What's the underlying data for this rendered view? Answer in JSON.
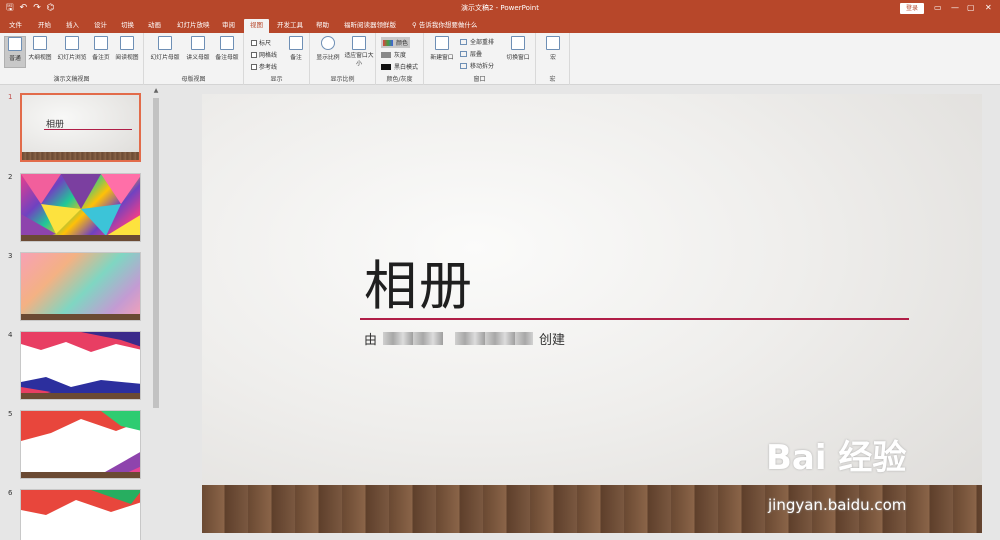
{
  "titlebar": {
    "qat": [
      "save-icon",
      "undo-icon",
      "redo-icon",
      "present-icon"
    ],
    "title": "演示文稿2 - PowerPoint",
    "login": "登录",
    "controls": [
      "▭",
      "—",
      "▢",
      "✕"
    ]
  },
  "tabs": [
    "文件",
    "开始",
    "插入",
    "设计",
    "切换",
    "动画",
    "幻灯片放映",
    "审阅",
    "视图",
    "开发工具",
    "帮助",
    "福昕阅读器领鲜版"
  ],
  "active_tab": "视图",
  "tell_me": "告诉我你想要做什么",
  "ribbon": {
    "presentation_views": {
      "label": "演示文稿视图",
      "buttons": [
        "普通",
        "大纲视图",
        "幻灯片浏览",
        "备注页",
        "阅读视图"
      ]
    },
    "master_views": {
      "label": "母版视图",
      "buttons": [
        "幻灯片母版",
        "讲义母版",
        "备注母版"
      ]
    },
    "show": {
      "label": "显示",
      "checks": [
        "标尺",
        "网格线",
        "参考线"
      ],
      "notes": "备注"
    },
    "zoom": {
      "label": "显示比例",
      "buttons": [
        "显示比例",
        "适应窗口大小"
      ]
    },
    "color": {
      "label": "颜色/灰度",
      "items": [
        "颜色",
        "灰度",
        "黑白模式"
      ]
    },
    "window": {
      "label": "窗口",
      "new_window": "新建窗口",
      "items": [
        "全部重排",
        "层叠",
        "移动拆分"
      ],
      "switch": "切换窗口"
    },
    "macros": {
      "label": "宏",
      "button": "宏"
    }
  },
  "thumbnails": [
    {
      "num": "1",
      "title": "相册"
    },
    {
      "num": "2"
    },
    {
      "num": "3"
    },
    {
      "num": "4"
    },
    {
      "num": "5"
    },
    {
      "num": "6"
    }
  ],
  "slide": {
    "title": "相册",
    "sub_prefix": "由",
    "sub_suffix": "创建",
    "line_color": "#b01e47"
  },
  "watermark": {
    "logo": "Bai 经验",
    "url": "jingyan.baidu.com"
  },
  "colors": {
    "accent": "#b7472a",
    "ribbon_bg": "#f3f3f3",
    "pane_bg": "#e6e6e6"
  }
}
